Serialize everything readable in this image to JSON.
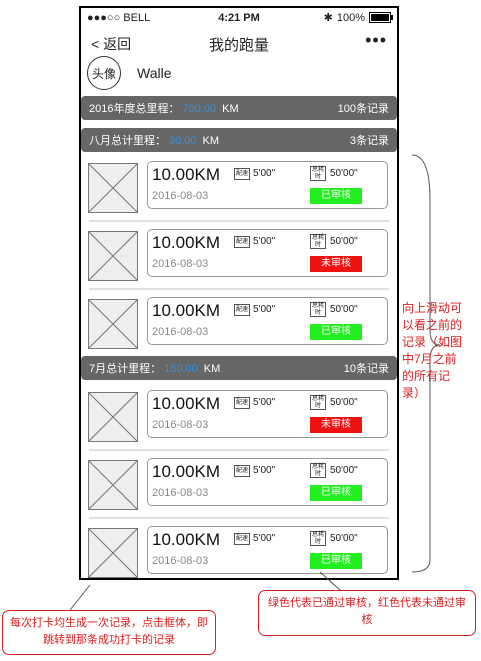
{
  "status": {
    "signal": "●●●○○ BELL",
    "wifi_icon": "wifi-icon",
    "time": "4:21 PM",
    "bluetooth": "✱",
    "battery": "100%"
  },
  "nav": {
    "back": "< 返回",
    "title": "我的跑量",
    "more": "•••"
  },
  "profile": {
    "avatar_label": "头像",
    "name": "Walle"
  },
  "year_summary": {
    "label": "2016年度总里程：",
    "value": "700.00",
    "unit": "KM",
    "count": "100条记录"
  },
  "months": [
    {
      "label": "八月总计里程：",
      "value": "30.00",
      "unit": "KM",
      "count": "3条记录"
    },
    {
      "label": "7月总计里程：",
      "value": "180.00",
      "unit": "KM",
      "count": "10条记录"
    }
  ],
  "record_labels": {
    "pace_icon": "配速",
    "time_icon": "总耗时"
  },
  "records": [
    {
      "distance": "10.00KM",
      "date": "2016-08-03",
      "pace": "5'00\"",
      "time": "50'00\"",
      "status": "已审核",
      "color": "#22ee22"
    },
    {
      "distance": "10.00KM",
      "date": "2016-08-03",
      "pace": "5'00\"",
      "time": "50'00\"",
      "status": "未审核",
      "color": "#ee1111"
    },
    {
      "distance": "10.00KM",
      "date": "2016-08-03",
      "pace": "5'00\"",
      "time": "50'00\"",
      "status": "已审核",
      "color": "#22ee22"
    },
    {
      "distance": "10.00KM",
      "date": "2016-08-03",
      "pace": "5'00\"",
      "time": "50'00\"",
      "status": "未审核",
      "color": "#ee1111"
    },
    {
      "distance": "10.00KM",
      "date": "2016-08-03",
      "pace": "5'00\"",
      "time": "50'00\"",
      "status": "已审核",
      "color": "#22ee22"
    },
    {
      "distance": "10.00KM",
      "date": "2016-08-03",
      "pace": "5'00\"",
      "time": "50'00\"",
      "status": "已审核",
      "color": "#22ee22"
    }
  ],
  "annotations": {
    "scroll_note": "向上滑动可以看之前的记录（如图中7月之前的所有记录）",
    "click_note": "每次打卡均生成一次记录，点击框体，即跳转到那条成功打卡的记录",
    "color_note": "绿色代表已通过审核，红色代表未通过审核"
  }
}
